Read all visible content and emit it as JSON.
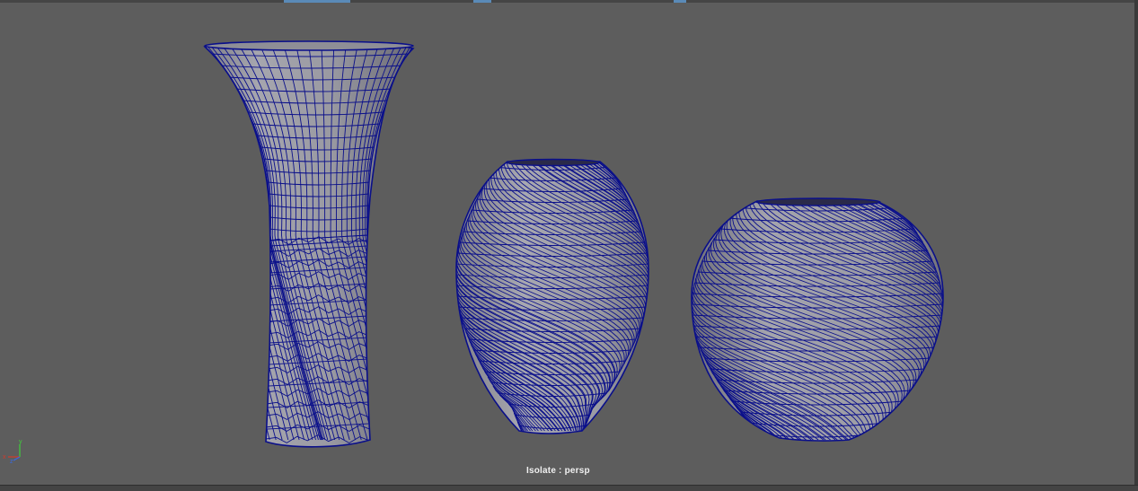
{
  "viewport": {
    "camera_label": "Isolate : persp",
    "background_color": "#5d5d5d",
    "wire_color": "#0a0f8a",
    "shade_color": "#9c9ca4"
  },
  "axis_gizmo": {
    "x_label": "x",
    "y_label": "y",
    "z_label": "z",
    "x_color": "#d33a2a",
    "y_color": "#3fcf3a",
    "z_color": "#3a6ae0"
  },
  "objects": [
    {
      "name": "tall-flared-vase"
    },
    {
      "name": "twisted-oval-vase"
    },
    {
      "name": "twisted-round-vase"
    }
  ],
  "toolbar_strip": {
    "active_color": "#5a8ab8"
  }
}
